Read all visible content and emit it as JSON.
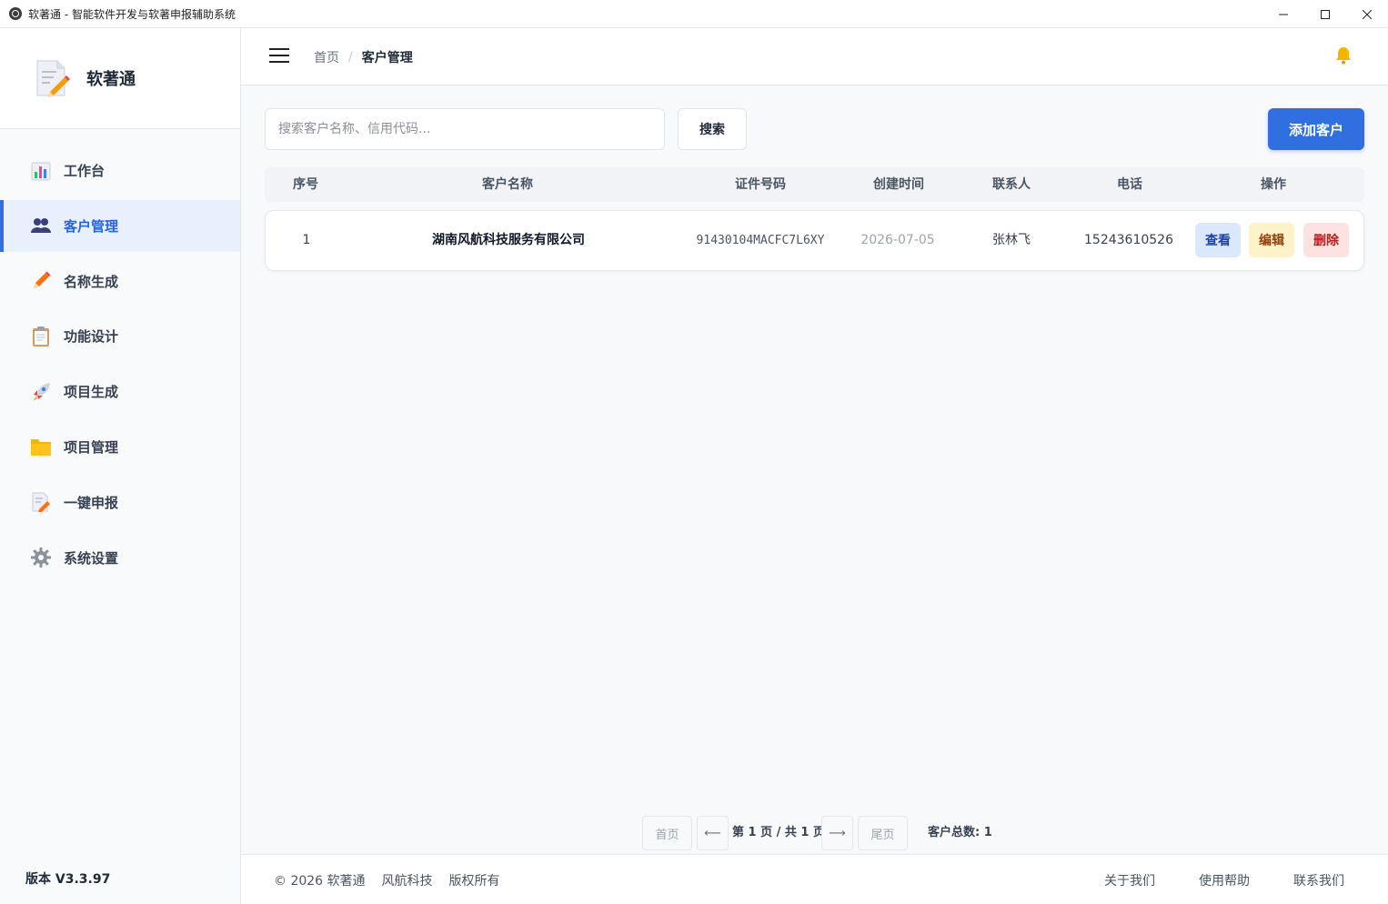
{
  "window": {
    "title": "软著通 - 智能软件开发与软著申报辅助系统"
  },
  "sidebar": {
    "brand": "软著通",
    "items": [
      {
        "label": "工作台",
        "icon": "chart-icon"
      },
      {
        "label": "客户管理",
        "icon": "users-icon",
        "active": true
      },
      {
        "label": "名称生成",
        "icon": "pencil-icon"
      },
      {
        "label": "功能设计",
        "icon": "clipboard-icon"
      },
      {
        "label": "项目生成",
        "icon": "rocket-icon"
      },
      {
        "label": "项目管理",
        "icon": "folder-icon"
      },
      {
        "label": "一键申报",
        "icon": "memo-icon"
      },
      {
        "label": "系统设置",
        "icon": "gear-icon"
      }
    ],
    "version": "版本 V3.3.97"
  },
  "header": {
    "breadcrumb_home": "首页",
    "breadcrumb_sep": "/",
    "breadcrumb_current": "客户管理"
  },
  "toolbar": {
    "search_placeholder": "搜索客户名称、信用代码...",
    "search_value": "",
    "search_button": "搜索",
    "add_button": "添加客户"
  },
  "table": {
    "columns": [
      "序号",
      "客户名称",
      "证件号码",
      "创建时间",
      "联系人",
      "电话",
      "操作"
    ],
    "rows": [
      {
        "index": "1",
        "name": "湖南风航科技服务有限公司",
        "code": "91430104MACFC7L6XY",
        "created": "2026-07-05",
        "contact": "张林飞",
        "phone": "15243610526",
        "actions": {
          "view": "查看",
          "edit": "编辑",
          "delete": "删除"
        }
      }
    ]
  },
  "pagination": {
    "first": "首页",
    "prev": "⟵",
    "info": "第 1 页 / 共 1 页",
    "next": "⟶",
    "last": "尾页",
    "total": "客户总数: 1"
  },
  "footer": {
    "copyright": "© 2026 软著通",
    "company": "风航科技",
    "rights": "版权所有",
    "about": "关于我们",
    "help": "使用帮助",
    "contact": "联系我们"
  },
  "colors": {
    "accent": "#2f6fe0",
    "active_bg": "#e8f0fd",
    "view_bg": "#dbe8fc",
    "edit_bg": "#fdf2c8",
    "delete_bg": "#fde2e2"
  }
}
